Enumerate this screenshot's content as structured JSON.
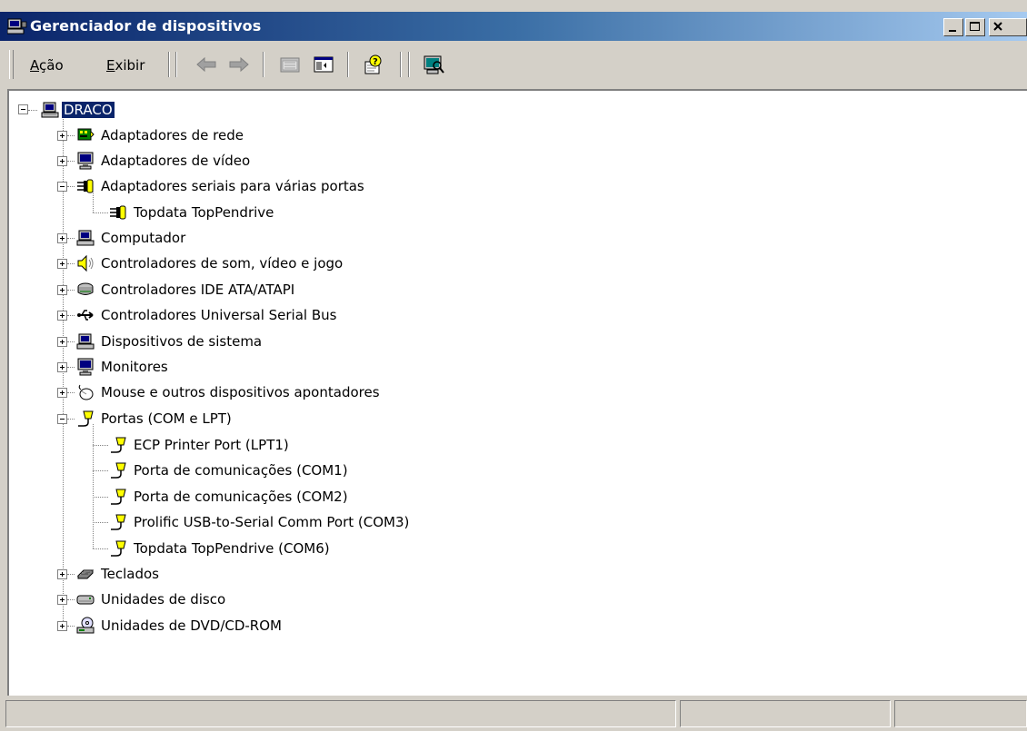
{
  "window": {
    "title": "Gerenciador de dispositivos",
    "icon": "computer-monitor-icon",
    "buttons": [
      "minimize-icon",
      "maximize-icon",
      "close-icon"
    ]
  },
  "menu": {
    "acao_label": "Ação",
    "exibir_label": "Exibir"
  },
  "toolbar": {
    "icons": [
      "back-arrow-icon",
      "forward-arrow-icon",
      "folder-up-icon",
      "show-hide-console-tree-icon",
      "help-icon",
      "scan-hardware-icon"
    ]
  },
  "tree": {
    "root": {
      "label": "DRACO",
      "expanded": true,
      "selected": true,
      "icon": "computer-icon"
    },
    "categories": [
      {
        "label": "Adaptadores de rede",
        "expanded": false,
        "icon": "network-adapter-icon"
      },
      {
        "label": "Adaptadores de vídeo",
        "expanded": false,
        "icon": "display-adapter-icon"
      },
      {
        "label": "Adaptadores seriais para várias portas",
        "expanded": true,
        "icon": "multiport-serial-icon",
        "children": [
          {
            "label": "Topdata TopPendrive",
            "icon": "multiport-serial-icon"
          }
        ]
      },
      {
        "label": "Computador",
        "expanded": false,
        "icon": "computer-icon"
      },
      {
        "label": "Controladores de som, vídeo e jogo",
        "expanded": false,
        "icon": "speaker-icon"
      },
      {
        "label": "Controladores IDE ATA/ATAPI",
        "expanded": false,
        "icon": "ide-controller-icon"
      },
      {
        "label": "Controladores Universal Serial Bus",
        "expanded": false,
        "icon": "usb-icon"
      },
      {
        "label": "Dispositivos de sistema",
        "expanded": false,
        "icon": "system-device-icon"
      },
      {
        "label": "Monitores",
        "expanded": false,
        "icon": "monitor-icon"
      },
      {
        "label": "Mouse e outros dispositivos apontadores",
        "expanded": false,
        "icon": "mouse-icon"
      },
      {
        "label": "Portas (COM e LPT)",
        "expanded": true,
        "icon": "port-connector-icon",
        "children": [
          {
            "label": "ECP Printer Port (LPT1)",
            "icon": "port-connector-icon"
          },
          {
            "label": "Porta de comunicações (COM1)",
            "icon": "port-connector-icon"
          },
          {
            "label": "Porta de comunicações (COM2)",
            "icon": "port-connector-icon"
          },
          {
            "label": "Prolific USB-to-Serial Comm Port (COM3)",
            "icon": "port-connector-icon"
          },
          {
            "label": "Topdata TopPendrive (COM6)",
            "icon": "port-connector-icon"
          }
        ]
      },
      {
        "label": "Teclados",
        "expanded": false,
        "icon": "keyboard-icon"
      },
      {
        "label": "Unidades de disco",
        "expanded": false,
        "icon": "disk-drive-icon"
      },
      {
        "label": "Unidades de DVD/CD-ROM",
        "expanded": false,
        "icon": "cdrom-drive-icon"
      }
    ]
  },
  "statusbar": {
    "panes": [
      "",
      "",
      ""
    ]
  },
  "colors": {
    "titlebar_start": "#0a246a",
    "titlebar_end": "#a6caf0",
    "face": "#d4d0c8",
    "selection": "#0a246a"
  }
}
